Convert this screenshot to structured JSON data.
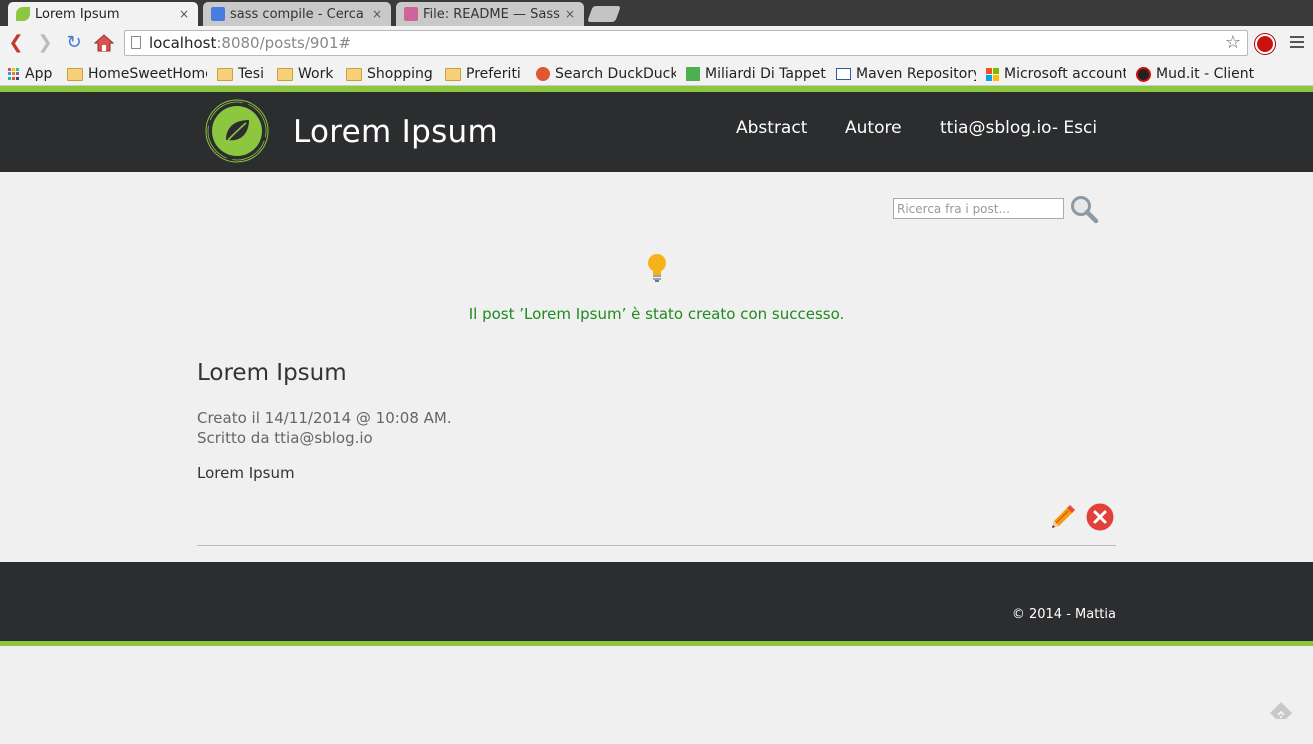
{
  "browser": {
    "tabs": [
      {
        "title": "Lorem Ipsum",
        "close": "×",
        "active": true
      },
      {
        "title": "sass compile - Cerca",
        "close": "×",
        "active": false
      },
      {
        "title": "File: README — Sass",
        "close": "×",
        "active": false
      }
    ],
    "url": {
      "host": "localhost",
      "path": ":8080/posts/901#"
    },
    "bookmarks": [
      {
        "label": "App",
        "icon": "apps-grid-icon"
      },
      {
        "label": "HomeSweetHome",
        "icon": "folder-icon"
      },
      {
        "label": "Tesi",
        "icon": "folder-icon"
      },
      {
        "label": "Work",
        "icon": "folder-icon"
      },
      {
        "label": "Shopping",
        "icon": "folder-icon"
      },
      {
        "label": "Preferiti",
        "icon": "folder-icon"
      },
      {
        "label": "Search DuckDuckGo",
        "icon": "duckduckgo-icon"
      },
      {
        "label": "Miliardi Di Tappeti",
        "icon": "ln-icon"
      },
      {
        "label": "Maven Repository",
        "icon": "mvn-icon"
      },
      {
        "label": "Microsoft account",
        "icon": "microsoft-icon"
      },
      {
        "label": "Mud.it - Client",
        "icon": "mud-icon"
      }
    ]
  },
  "header": {
    "title": "Lorem Ipsum",
    "nav": {
      "abstract": "Abstract",
      "author": "Autore",
      "user": "ttia@sblog.io- Esci"
    }
  },
  "search": {
    "placeholder": "Ricerca fra i post..."
  },
  "flash": {
    "message": "Il post ’Lorem Ipsum’ è stato creato con successo."
  },
  "post": {
    "title": "Lorem Ipsum",
    "created": "Creato il 14/11/2014 @ 10:08 AM.",
    "author": "Scritto da ttia@sblog.io",
    "body": "Lorem Ipsum"
  },
  "footer": {
    "copyright": "© 2014 - Mattia"
  },
  "colors": {
    "accent": "#8dc63f",
    "dark": "#2c2d2f",
    "success": "#1f8a1f",
    "delete": "#e2403b"
  }
}
